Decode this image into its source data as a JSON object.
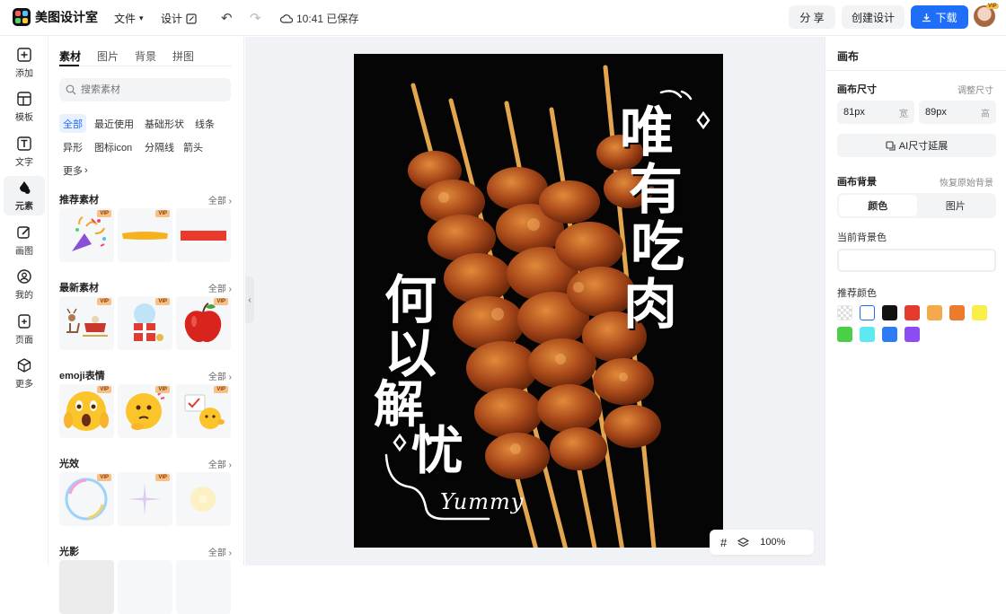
{
  "app": {
    "name": "美图设计室"
  },
  "topbar": {
    "file_menu": "文件",
    "design_menu": "设计",
    "save_status": "10:41 已保存",
    "share_label": "分 享",
    "create_label": "创建设计",
    "download_label": "下载",
    "avatar_badge": "VIP"
  },
  "leftnav": {
    "items": [
      {
        "label": "添加",
        "icon": "plus-square-icon"
      },
      {
        "label": "模板",
        "icon": "template-icon"
      },
      {
        "label": "文字",
        "icon": "text-icon"
      },
      {
        "label": "元素",
        "icon": "element-icon",
        "active": true
      },
      {
        "label": "画图",
        "icon": "draw-icon"
      },
      {
        "label": "我的",
        "icon": "user-icon"
      },
      {
        "label": "页面",
        "icon": "page-icon"
      },
      {
        "label": "更多",
        "icon": "cube-icon"
      }
    ]
  },
  "panel": {
    "tabs": [
      "素材",
      "图片",
      "背景",
      "拼图"
    ],
    "search_placeholder": "搜索素材",
    "chips": [
      "全部",
      "最近使用",
      "基础形状",
      "线条",
      "异形",
      "图标icon",
      "分隔线",
      "箭头",
      "更多"
    ],
    "sections": [
      {
        "title": "推荐素材",
        "more": "全部"
      },
      {
        "title": "最新素材",
        "more": "全部"
      },
      {
        "title": "emoji表情",
        "more": "全部"
      },
      {
        "title": "光效",
        "more": "全部"
      },
      {
        "title": "光影",
        "more": "全部"
      }
    ],
    "vip_badge": "VIP"
  },
  "artboard": {
    "headline_right": [
      "唯",
      "有",
      "吃",
      "肉"
    ],
    "headline_left_1": "何以",
    "headline_left_2": "解",
    "headline_left_3": "忧",
    "script_text": "Yummy"
  },
  "canvas_toolbar": {
    "zoom": "100%"
  },
  "rightpanel": {
    "title": "画布",
    "size_label": "画布尺寸",
    "size_link": "调整尺寸",
    "width_value": "81px",
    "width_unit": "宽",
    "height_value": "89px",
    "height_unit": "高",
    "ai_button": "AI尺寸延展",
    "bg_label": "画布背景",
    "bg_link": "恢复原始背景",
    "seg_color": "颜色",
    "seg_image": "图片",
    "current_bg_label": "当前背景色",
    "rec_label": "推荐颜色",
    "swatches": [
      "transparent",
      "#ffffff",
      "#111111",
      "#e53b2c",
      "#f4a94a",
      "#ee7a2c",
      "#f8ef4a",
      "#4ccf48",
      "#5ce9ef",
      "#2d7cf3",
      "#8d4cf2"
    ]
  }
}
